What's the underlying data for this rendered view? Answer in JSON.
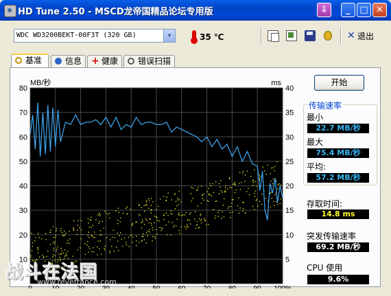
{
  "window": {
    "title": "HD Tune 2.50 - MSCD龙帝国精品论坛专用版"
  },
  "toolbar": {
    "drive": "WDC WD3200BEKT-00F3T (320 GB)",
    "temperature": "35 ℃",
    "exit_label": "退出",
    "icons": [
      "copy-icon",
      "copy-text-icon",
      "save-icon",
      "options-icon",
      "exit-icon"
    ]
  },
  "tabs": [
    {
      "label": "基准",
      "icon": "benchmark-icon",
      "active": true
    },
    {
      "label": "信息",
      "icon": "info-icon",
      "active": false
    },
    {
      "label": "健康",
      "icon": "health-icon",
      "active": false
    },
    {
      "label": "错误扫描",
      "icon": "error-scan-icon",
      "active": false
    }
  ],
  "right_panel": {
    "start_button": "开始",
    "transfer_rate_title": "传输速率",
    "min_label": "最小",
    "min_value": "22.7 MB/秒",
    "max_label": "最大",
    "max_value": "75.4 MB/秒",
    "avg_label": "平均:",
    "avg_value": "57.2 MB/秒",
    "access_time_label": "存取时间:",
    "access_time_value": "14.8 ms",
    "burst_rate_label": "突发传输速率",
    "burst_rate_value": "69.2 MB/秒",
    "cpu_label": "CPU 使用",
    "cpu_value": "9.6%"
  },
  "watermark": {
    "text": "战斗在法国",
    "url": "www.revefrance.com"
  },
  "chart_data": {
    "type": "line",
    "background": "#000000",
    "grid": true,
    "y_left_label": "MB/秒",
    "y_right_label": "ms",
    "y_left_range": [
      0,
      80
    ],
    "y_right_range": [
      0,
      40
    ],
    "y_left_ticks": [
      "80",
      "70",
      "60",
      "50",
      "40",
      "30",
      "20",
      "10"
    ],
    "y_right_ticks": [
      "40",
      "35",
      "30",
      "25",
      "20",
      "15",
      "10",
      "5"
    ],
    "x_range": [
      0,
      100
    ],
    "x_ticks": [
      "0",
      "10",
      "20",
      "30",
      "40",
      "50",
      "60",
      "70",
      "80",
      "90",
      "100%"
    ],
    "transfer_rate": {
      "color": "#3ca0e6",
      "x": [
        0,
        1,
        2,
        3,
        4,
        5,
        6,
        7,
        8,
        9,
        10,
        11,
        12,
        14,
        16,
        18,
        20,
        22,
        24,
        26,
        28,
        30,
        32,
        34,
        36,
        38,
        40,
        42,
        44,
        46,
        48,
        50,
        52,
        54,
        56,
        58,
        60,
        62,
        64,
        66,
        68,
        70,
        72,
        74,
        76,
        78,
        80,
        82,
        84,
        86,
        88,
        90,
        91,
        92,
        93,
        94,
        95,
        96,
        97,
        98,
        99,
        100
      ],
      "y": [
        61,
        69,
        55,
        74,
        52,
        70,
        53,
        73,
        54,
        72,
        56,
        71,
        58,
        66,
        65,
        69,
        65,
        66,
        66,
        67,
        65,
        68,
        64,
        68,
        63,
        65,
        64,
        68,
        65,
        66,
        66,
        65,
        65,
        66,
        62,
        64,
        63,
        62,
        61,
        60,
        58,
        60,
        56,
        59,
        55,
        57,
        52,
        56,
        50,
        54,
        49,
        48,
        38,
        46,
        30,
        26,
        41,
        37,
        43,
        33,
        40,
        35
      ]
    },
    "access_time": {
      "color": "#ffff30",
      "type": "scatter",
      "trend_start_ms": 6,
      "trend_end_ms": 21,
      "spread_ms": 4.5
    }
  }
}
